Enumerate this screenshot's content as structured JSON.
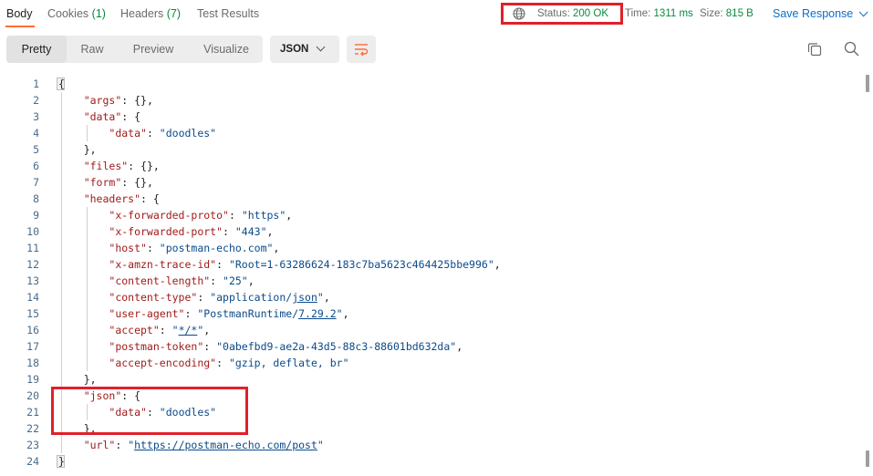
{
  "tabs": [
    {
      "label": "Body",
      "count": ""
    },
    {
      "label": "Cookies",
      "count": "(1)"
    },
    {
      "label": "Headers",
      "count": "(7)"
    },
    {
      "label": "Test Results",
      "count": ""
    }
  ],
  "status": {
    "label": "Status:",
    "value": "200 OK"
  },
  "time": {
    "label": "Time:",
    "value": "1311 ms"
  },
  "size": {
    "label": "Size:",
    "value": "815 B"
  },
  "save_response": "Save Response",
  "view_modes": [
    "Pretty",
    "Raw",
    "Preview",
    "Visualize"
  ],
  "active_view": "Pretty",
  "format": "JSON",
  "colors": {
    "accent": "#ff6c37",
    "highlight": "#e0202a",
    "link": "#0b6ec9",
    "key": "#a11b1b",
    "string": "#0b4a8b"
  },
  "icons": [
    "globe-icon",
    "wrap-lines-icon",
    "copy-icon",
    "search-icon",
    "chevron-down-icon"
  ],
  "code_lines": [
    "{",
    "    \"args\": {},",
    "    \"data\": {",
    "        \"data\": \"doodles\"",
    "    },",
    "    \"files\": {},",
    "    \"form\": {},",
    "    \"headers\": {",
    "        \"x-forwarded-proto\": \"https\",",
    "        \"x-forwarded-port\": \"443\",",
    "        \"host\": \"postman-echo.com\",",
    "        \"x-amzn-trace-id\": \"Root=1-63286624-183c7ba5623c464425bbe996\",",
    "        \"content-length\": \"25\",",
    "        \"content-type\": \"application/json\",",
    "        \"user-agent\": \"PostmanRuntime/7.29.2\",",
    "        \"accept\": \"*/*\",",
    "        \"postman-token\": \"0abefbd9-ae2a-43d5-88c3-88601bd632da\",",
    "        \"accept-encoding\": \"gzip, deflate, br\"",
    "    },",
    "    \"json\": {",
    "        \"data\": \"doodles\"",
    "    },",
    "    \"url\": \"https://postman-echo.com/post\"",
    "}"
  ]
}
